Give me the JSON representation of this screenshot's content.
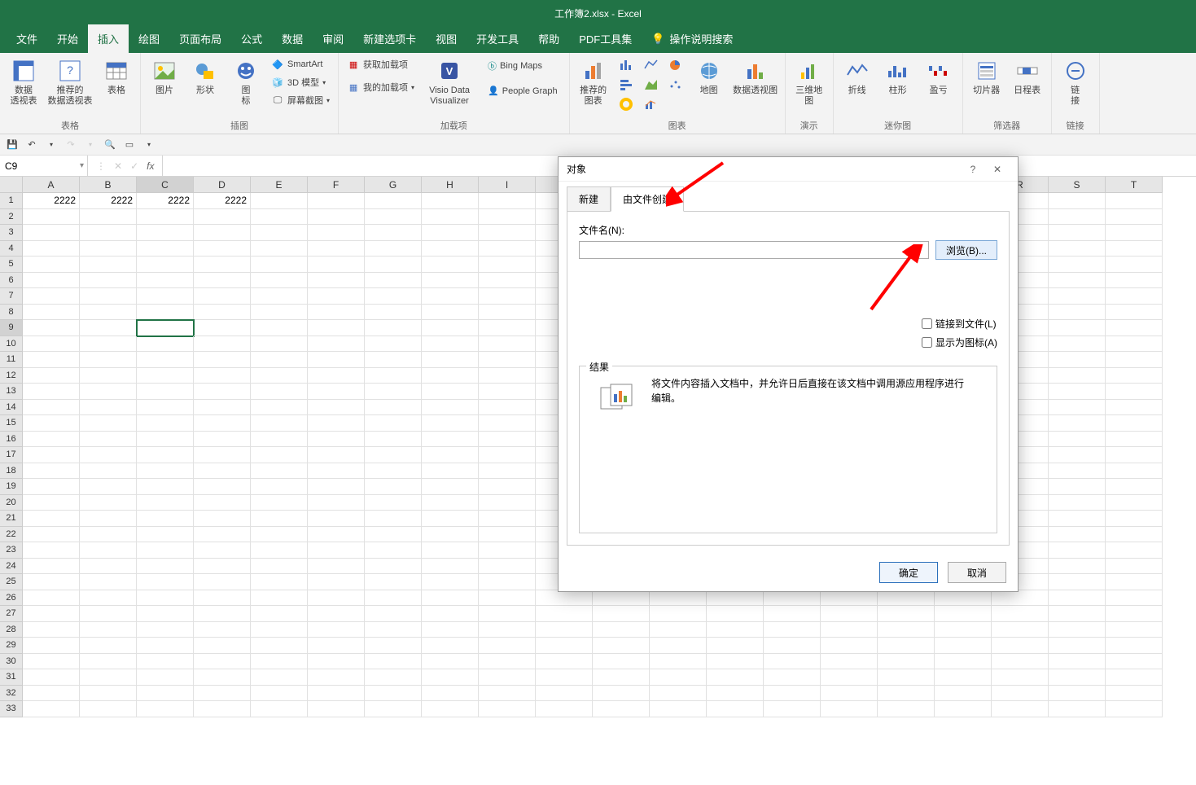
{
  "title": "工作簿2.xlsx  -  Excel",
  "tabs": [
    "文件",
    "开始",
    "插入",
    "绘图",
    "页面布局",
    "公式",
    "数据",
    "审阅",
    "新建选项卡",
    "视图",
    "开发工具",
    "帮助",
    "PDF工具集"
  ],
  "tell_me": "操作说明搜索",
  "active_tab_index": 2,
  "ribbon": {
    "groups": {
      "tables": {
        "label": "表格",
        "pivot": "数据\n透视表",
        "rec_pivot": "推荐的\n数据透视表",
        "table": "表格"
      },
      "illus": {
        "label": "插图",
        "pic": "图片",
        "shapes": "形状",
        "icons": "图\n标",
        "smartart": "SmartArt",
        "model3d": "3D 模型",
        "screenshot": "屏幕截图"
      },
      "addins": {
        "label": "加载项",
        "get": "获取加载项",
        "my": "我的加载项",
        "visio": "Visio Data\nVisualizer",
        "bing": "Bing Maps",
        "people": "People Graph"
      },
      "charts": {
        "label": "图表",
        "rec": "推荐的\n图表",
        "map": "地图",
        "pivotchart": "数据透视图"
      },
      "tours": {
        "label": "演示",
        "map3d": "三维地\n图"
      },
      "spark": {
        "label": "迷你图",
        "line": "折线",
        "col": "柱形",
        "winloss": "盈亏"
      },
      "filters": {
        "label": "筛选器",
        "slicer": "切片器",
        "timeline": "日程表"
      },
      "links": {
        "label": "链接",
        "link": "链\n接"
      }
    }
  },
  "name_box": "C9",
  "columns": [
    "A",
    "B",
    "C",
    "D",
    "E",
    "F",
    "G",
    "H",
    "I",
    "R",
    "S"
  ],
  "row_count": 33,
  "data_row": {
    "A": "2222",
    "B": "2222",
    "C": "2222",
    "D": "2222"
  },
  "selected": {
    "row": 9,
    "col": "C"
  },
  "dialog": {
    "title": "对象",
    "tabs": {
      "new": "新建",
      "fromfile": "由文件创建"
    },
    "filename_label": "文件名(N):",
    "browse": "浏览(B)...",
    "link": "链接到文件(L)",
    "icon": "显示为图标(A)",
    "result_label": "结果",
    "result_text": "将文件内容插入文档中，并允许日后直接在该文档中调用源应用程序进行编辑。",
    "ok": "确定",
    "cancel": "取消"
  }
}
